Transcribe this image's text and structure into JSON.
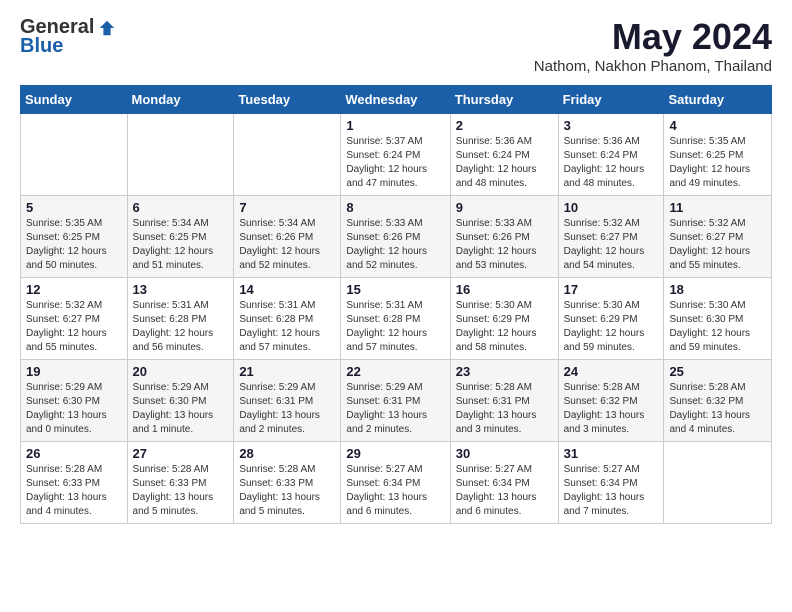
{
  "logo": {
    "general": "General",
    "blue": "Blue"
  },
  "title": "May 2024",
  "subtitle": "Nathom, Nakhon Phanom, Thailand",
  "days": [
    "Sunday",
    "Monday",
    "Tuesday",
    "Wednesday",
    "Thursday",
    "Friday",
    "Saturday"
  ],
  "weeks": [
    [
      {
        "num": "",
        "info": ""
      },
      {
        "num": "",
        "info": ""
      },
      {
        "num": "",
        "info": ""
      },
      {
        "num": "1",
        "info": "Sunrise: 5:37 AM\nSunset: 6:24 PM\nDaylight: 12 hours\nand 47 minutes."
      },
      {
        "num": "2",
        "info": "Sunrise: 5:36 AM\nSunset: 6:24 PM\nDaylight: 12 hours\nand 48 minutes."
      },
      {
        "num": "3",
        "info": "Sunrise: 5:36 AM\nSunset: 6:24 PM\nDaylight: 12 hours\nand 48 minutes."
      },
      {
        "num": "4",
        "info": "Sunrise: 5:35 AM\nSunset: 6:25 PM\nDaylight: 12 hours\nand 49 minutes."
      }
    ],
    [
      {
        "num": "5",
        "info": "Sunrise: 5:35 AM\nSunset: 6:25 PM\nDaylight: 12 hours\nand 50 minutes."
      },
      {
        "num": "6",
        "info": "Sunrise: 5:34 AM\nSunset: 6:25 PM\nDaylight: 12 hours\nand 51 minutes."
      },
      {
        "num": "7",
        "info": "Sunrise: 5:34 AM\nSunset: 6:26 PM\nDaylight: 12 hours\nand 52 minutes."
      },
      {
        "num": "8",
        "info": "Sunrise: 5:33 AM\nSunset: 6:26 PM\nDaylight: 12 hours\nand 52 minutes."
      },
      {
        "num": "9",
        "info": "Sunrise: 5:33 AM\nSunset: 6:26 PM\nDaylight: 12 hours\nand 53 minutes."
      },
      {
        "num": "10",
        "info": "Sunrise: 5:32 AM\nSunset: 6:27 PM\nDaylight: 12 hours\nand 54 minutes."
      },
      {
        "num": "11",
        "info": "Sunrise: 5:32 AM\nSunset: 6:27 PM\nDaylight: 12 hours\nand 55 minutes."
      }
    ],
    [
      {
        "num": "12",
        "info": "Sunrise: 5:32 AM\nSunset: 6:27 PM\nDaylight: 12 hours\nand 55 minutes."
      },
      {
        "num": "13",
        "info": "Sunrise: 5:31 AM\nSunset: 6:28 PM\nDaylight: 12 hours\nand 56 minutes."
      },
      {
        "num": "14",
        "info": "Sunrise: 5:31 AM\nSunset: 6:28 PM\nDaylight: 12 hours\nand 57 minutes."
      },
      {
        "num": "15",
        "info": "Sunrise: 5:31 AM\nSunset: 6:28 PM\nDaylight: 12 hours\nand 57 minutes."
      },
      {
        "num": "16",
        "info": "Sunrise: 5:30 AM\nSunset: 6:29 PM\nDaylight: 12 hours\nand 58 minutes."
      },
      {
        "num": "17",
        "info": "Sunrise: 5:30 AM\nSunset: 6:29 PM\nDaylight: 12 hours\nand 59 minutes."
      },
      {
        "num": "18",
        "info": "Sunrise: 5:30 AM\nSunset: 6:30 PM\nDaylight: 12 hours\nand 59 minutes."
      }
    ],
    [
      {
        "num": "19",
        "info": "Sunrise: 5:29 AM\nSunset: 6:30 PM\nDaylight: 13 hours\nand 0 minutes."
      },
      {
        "num": "20",
        "info": "Sunrise: 5:29 AM\nSunset: 6:30 PM\nDaylight: 13 hours\nand 1 minute."
      },
      {
        "num": "21",
        "info": "Sunrise: 5:29 AM\nSunset: 6:31 PM\nDaylight: 13 hours\nand 2 minutes."
      },
      {
        "num": "22",
        "info": "Sunrise: 5:29 AM\nSunset: 6:31 PM\nDaylight: 13 hours\nand 2 minutes."
      },
      {
        "num": "23",
        "info": "Sunrise: 5:28 AM\nSunset: 6:31 PM\nDaylight: 13 hours\nand 3 minutes."
      },
      {
        "num": "24",
        "info": "Sunrise: 5:28 AM\nSunset: 6:32 PM\nDaylight: 13 hours\nand 3 minutes."
      },
      {
        "num": "25",
        "info": "Sunrise: 5:28 AM\nSunset: 6:32 PM\nDaylight: 13 hours\nand 4 minutes."
      }
    ],
    [
      {
        "num": "26",
        "info": "Sunrise: 5:28 AM\nSunset: 6:33 PM\nDaylight: 13 hours\nand 4 minutes."
      },
      {
        "num": "27",
        "info": "Sunrise: 5:28 AM\nSunset: 6:33 PM\nDaylight: 13 hours\nand 5 minutes."
      },
      {
        "num": "28",
        "info": "Sunrise: 5:28 AM\nSunset: 6:33 PM\nDaylight: 13 hours\nand 5 minutes."
      },
      {
        "num": "29",
        "info": "Sunrise: 5:27 AM\nSunset: 6:34 PM\nDaylight: 13 hours\nand 6 minutes."
      },
      {
        "num": "30",
        "info": "Sunrise: 5:27 AM\nSunset: 6:34 PM\nDaylight: 13 hours\nand 6 minutes."
      },
      {
        "num": "31",
        "info": "Sunrise: 5:27 AM\nSunset: 6:34 PM\nDaylight: 13 hours\nand 7 minutes."
      },
      {
        "num": "",
        "info": ""
      }
    ]
  ]
}
